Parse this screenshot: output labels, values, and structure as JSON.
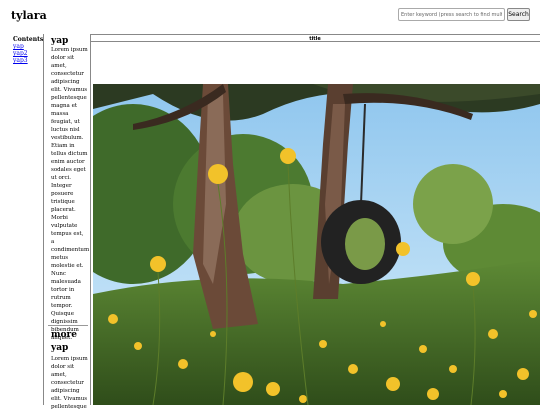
{
  "header": {
    "site_title": "tylara",
    "search_placeholder": "Enter keyword (press search to find multiple)",
    "search_button": "Search"
  },
  "toc": {
    "title": "Contents",
    "links": [
      "yap",
      "yap2",
      "yap3"
    ]
  },
  "article": {
    "section1_title": "yap",
    "section1_text": "Lorem ipsum dolor sit amet, consectetur adipiscing elit. Vivamus pellentesque magna et massa feugiat, ut luctus nisl vestibulum. Etiam in tellus dictum enim auctor sodales eget ut orci. Integer posuere tristique placerat. Morbi vulputate tempus est, a condimentum metus molestie et. Nunc malesuada tortor in rutrum tempor. Quisque dignissim bibendum aliquet.",
    "section2_title": "more yap",
    "section2_text": "Lorem ipsum dolor sit amet, consectetur adipiscing elit. Vivamus pellentesque"
  },
  "frame": {
    "title": "title"
  },
  "photo": {
    "subject": "tire swing hanging from a tree over a field of yellow wildflowers"
  }
}
